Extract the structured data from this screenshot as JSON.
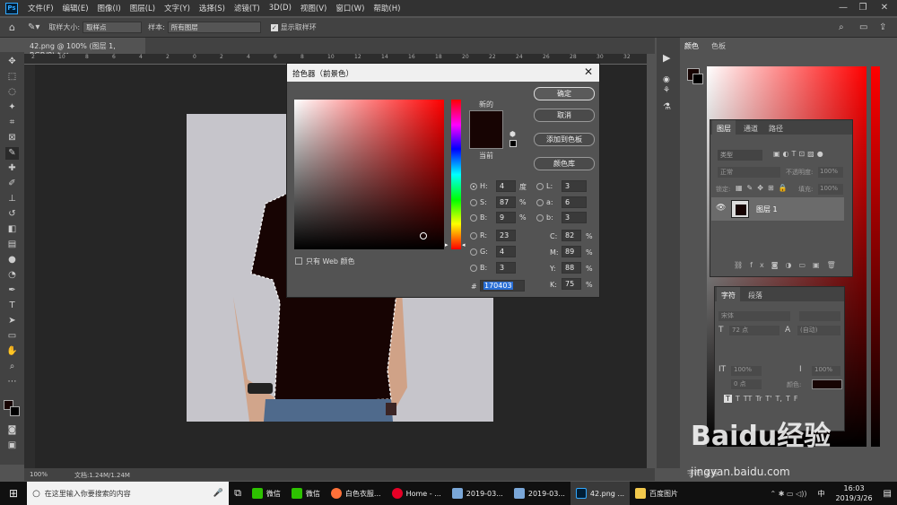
{
  "app": {
    "logo": "Ps",
    "menus": [
      "文件(F)",
      "编辑(E)",
      "图像(I)",
      "图层(L)",
      "文字(Y)",
      "选择(S)",
      "滤镜(T)",
      "3D(D)",
      "视图(V)",
      "窗口(W)",
      "帮助(H)"
    ],
    "win_buttons": [
      "—",
      "❐",
      "✕"
    ]
  },
  "options": {
    "sample_size_label": "取样大小:",
    "sample_size_value": "取样点",
    "sample_label": "样本:",
    "sample_value": "所有图层",
    "show_ring_label": "显示取样环"
  },
  "document": {
    "tab_title": "42.png @ 100% (图层 1, RGB/8) *",
    "zoom": "100%",
    "doc_info": "文档:1.24M/1.24M"
  },
  "ruler": {
    "ticks": [
      "2",
      "10",
      "8",
      "6",
      "4",
      "2",
      "0",
      "2",
      "4",
      "6",
      "8",
      "10",
      "12",
      "14",
      "16",
      "18",
      "20",
      "22",
      "24",
      "26",
      "28",
      "30",
      "32"
    ]
  },
  "dialog": {
    "title": "拾色器（前景色）",
    "new_label": "新的",
    "current_label": "当前",
    "ok": "确定",
    "cancel": "取消",
    "add_swatch": "添加到色板",
    "libraries": "颜色库",
    "web_only": "只有 Web 颜色",
    "hsb": [
      {
        "label": "H:",
        "value": "4",
        "unit": "度"
      },
      {
        "label": "S:",
        "value": "87",
        "unit": "%"
      },
      {
        "label": "B:",
        "value": "9",
        "unit": "%"
      }
    ],
    "rgb": [
      {
        "label": "R:",
        "value": "23"
      },
      {
        "label": "G:",
        "value": "4"
      },
      {
        "label": "B:",
        "value": "3"
      }
    ],
    "lab": [
      {
        "label": "L:",
        "value": "3"
      },
      {
        "label": "a:",
        "value": "6"
      },
      {
        "label": "b:",
        "value": "3"
      }
    ],
    "cmyk": [
      {
        "label": "C:",
        "value": "82",
        "unit": "%"
      },
      {
        "label": "M:",
        "value": "89",
        "unit": "%"
      },
      {
        "label": "Y:",
        "value": "88",
        "unit": "%"
      },
      {
        "label": "K:",
        "value": "75",
        "unit": "%"
      }
    ],
    "hex_label": "#",
    "hex": "170403",
    "selected_color": "#170403"
  },
  "panels": {
    "color_tabs": [
      "颜色",
      "色板"
    ],
    "layers_tabs": [
      "图层",
      "通道",
      "路径"
    ],
    "layers_search": "类型",
    "blend_mode": "正常",
    "opacity_label": "不透明度:",
    "opacity": "100%",
    "lock_label": "锁定:",
    "fill_label": "填充:",
    "fill": "100%",
    "layer_name": "图层 1",
    "char_tabs": [
      "字符",
      "段落"
    ],
    "char_font": "宋体",
    "char_size": "72 点",
    "char_leading": "(自动)",
    "char_scale_v": "100%",
    "char_scale_h": "100%",
    "char_baseline": "0 点",
    "char_color_label": "颜色:",
    "type_buttons": [
      "T",
      "T",
      "TT",
      "Tr",
      "T'",
      "T,",
      "T",
      "F"
    ],
    "bottom_text": "字符  段落"
  },
  "taskbar": {
    "search_placeholder": "在这里输入你要搜索的内容",
    "items": [
      "微信",
      "微信",
      "白色衣服...",
      "Home - ...",
      "2019-03...",
      "2019-03...",
      "42.png ...",
      "百度图片"
    ],
    "time": "16:03",
    "date": "2019/3/26",
    "ime": "中"
  },
  "watermark": {
    "text": "Baidu经验",
    "url": "jingyan.baidu.com"
  }
}
